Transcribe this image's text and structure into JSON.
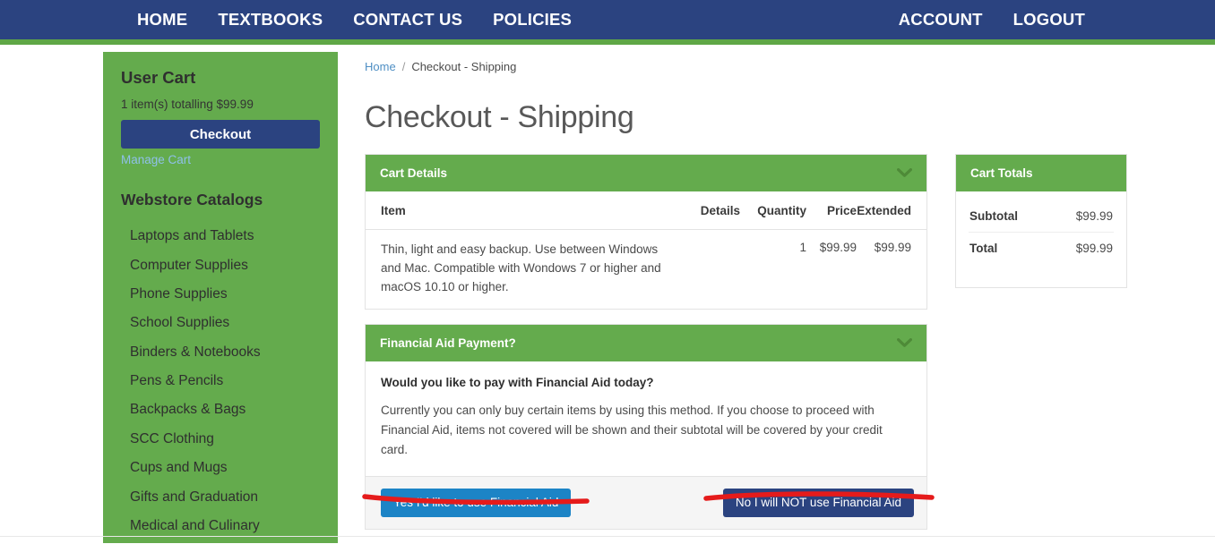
{
  "nav": {
    "left_items": [
      {
        "label": "HOME",
        "name": "nav-home"
      },
      {
        "label": "TEXTBOOKS",
        "name": "nav-textbooks"
      },
      {
        "label": "CONTACT US",
        "name": "nav-contact-us"
      },
      {
        "label": "POLICIES",
        "name": "nav-policies"
      }
    ],
    "right_items": [
      {
        "label": "ACCOUNT",
        "name": "nav-account"
      },
      {
        "label": "LOGOUT",
        "name": "nav-logout"
      }
    ]
  },
  "sidebar": {
    "cart_title": "User Cart",
    "cart_summary": "1 item(s) totalling $99.99",
    "checkout_label": "Checkout",
    "manage_cart_label": "Manage Cart",
    "catalogs_title": "Webstore Catalogs",
    "catalogs": [
      "Laptops and Tablets",
      "Computer Supplies",
      "Phone Supplies",
      "School Supplies",
      "Binders & Notebooks",
      "Pens & Pencils",
      "Backpacks & Bags",
      "SCC Clothing",
      "Cups and Mugs",
      "Gifts and Graduation",
      "Medical and Culinary"
    ]
  },
  "breadcrumb": {
    "home": "Home",
    "separator": "/",
    "current": "Checkout - Shipping"
  },
  "page_title": "Checkout - Shipping",
  "cart_details": {
    "panel_title": "Cart Details",
    "collapse_icon": "chevron-down-icon",
    "columns": [
      "Item",
      "Details",
      "Quantity",
      "Price",
      "Extended"
    ],
    "rows": [
      {
        "item": "Thin, light and easy backup. Use between Windows and Mac. Compatible with Wondows 7 or higher and macOS 10.10 or higher.",
        "details": "",
        "quantity": "1",
        "price": "$99.99",
        "extended": "$99.99"
      }
    ]
  },
  "financial_aid": {
    "panel_title": "Financial Aid Payment?",
    "collapse_icon": "chevron-down-icon",
    "question": "Would you like to pay with Financial Aid today?",
    "description": "Currently you can only buy certain items by using this method. If you choose to proceed with Financial Aid, items not covered will be shown and their subtotal will be covered by your credit card.",
    "yes_label": "Yes I'd like to use Financial Aid",
    "no_label": "No I will NOT use Financial Aid"
  },
  "cart_totals": {
    "panel_title": "Cart Totals",
    "rows": [
      {
        "label": "Subtotal",
        "value": "$99.99"
      },
      {
        "label": "Total",
        "value": "$99.99"
      }
    ]
  },
  "colors": {
    "navy": "#2b4380",
    "green": "#64ab4d",
    "blue_button": "#1c84c6",
    "annotation_red": "#e51b1b",
    "link_blue": "#4f8fc4"
  }
}
